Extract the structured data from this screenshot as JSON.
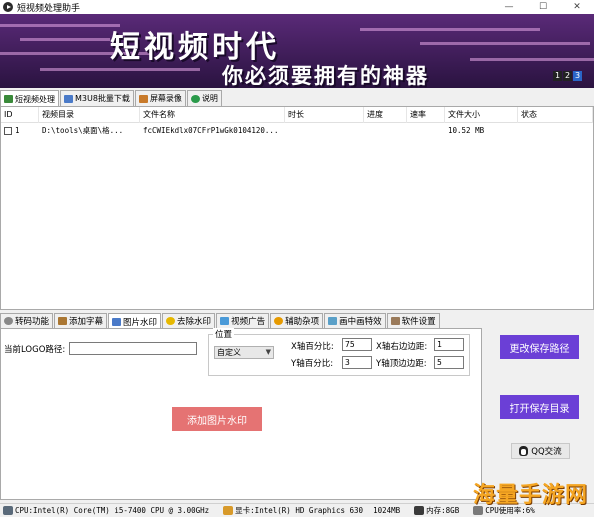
{
  "window": {
    "title": "短视频处理助手",
    "min_symbol": "—",
    "max_symbol": "☐",
    "close_symbol": "✕"
  },
  "banner": {
    "title": "短视频时代",
    "subtitle": "你必须要拥有的神器",
    "pages": [
      "1",
      "2",
      "3"
    ],
    "active_page": "3"
  },
  "top_tabs": [
    {
      "label": "短视频处理",
      "icon": "scissors-icon",
      "color": "#3a8a3a"
    },
    {
      "label": "M3U8批量下载",
      "icon": "film-icon",
      "color": "#4a7ac8"
    },
    {
      "label": "屏幕录像",
      "icon": "camera-icon",
      "color": "#c87a2a"
    },
    {
      "label": "说明",
      "icon": "info-icon",
      "color": "#2a9a4a"
    }
  ],
  "table": {
    "columns": [
      "ID",
      "视频目录",
      "文件名称",
      "时长",
      "进度",
      "速率",
      "文件大小",
      "状态"
    ],
    "rows": [
      {
        "id": "1",
        "dir": "D:\\tools\\桌面\\格...",
        "name": "fcCWIEkdlx07CFrP1wGk0104120...",
        "duration": "",
        "progress": "",
        "rate": "",
        "size": "10.52 MB",
        "status": ""
      }
    ]
  },
  "bottom_tabs": [
    {
      "label": "转码功能",
      "icon": "gear-icon",
      "color": "#888888"
    },
    {
      "label": "添加字幕",
      "icon": "pen-icon",
      "color": "#aa7733"
    },
    {
      "label": "图片水印",
      "icon": "image-icon",
      "color": "#4a7ac8"
    },
    {
      "label": "去除水印",
      "icon": "eraser-icon",
      "color": "#e6b800"
    },
    {
      "label": "视频广告",
      "icon": "tv-icon",
      "color": "#4a9ad8"
    },
    {
      "label": "辅助杂项",
      "icon": "tools-icon",
      "color": "#e69a00"
    },
    {
      "label": "画中画特效",
      "icon": "pip-icon",
      "color": "#5aa0c8"
    },
    {
      "label": "软件设置",
      "icon": "settings-icon",
      "color": "#9a7a5a"
    }
  ],
  "watermark_panel": {
    "logo_path_label": "当前LOGO路径:",
    "logo_path_value": "",
    "position_group_label": "位置",
    "position_select": "自定义",
    "x_percent_label": "X轴百分比:",
    "x_percent_value": "75",
    "y_percent_label": "Y轴百分比:",
    "y_percent_value": "3",
    "x_right_margin_label": "X轴右边边距:",
    "x_right_margin_value": "1",
    "y_top_margin_label": "Y轴顶边边距:",
    "y_top_margin_value": "5",
    "add_button": "添加图片水印"
  },
  "side_actions": {
    "change_path": "更改保存路径",
    "open_dir": "打开保存目录",
    "qq": "QQ交流"
  },
  "status_bar": {
    "cpu": "CPU:Intel(R) Core(TM) i5-7400 CPU @ 3.00GHz",
    "gpu": "显卡:Intel(R) HD Graphics 630",
    "gpu_mem": "1024MB",
    "memory": "内存:8GB",
    "cpu_usage": "CPU使用率:6%"
  },
  "overlay_watermark": "海量手游网"
}
